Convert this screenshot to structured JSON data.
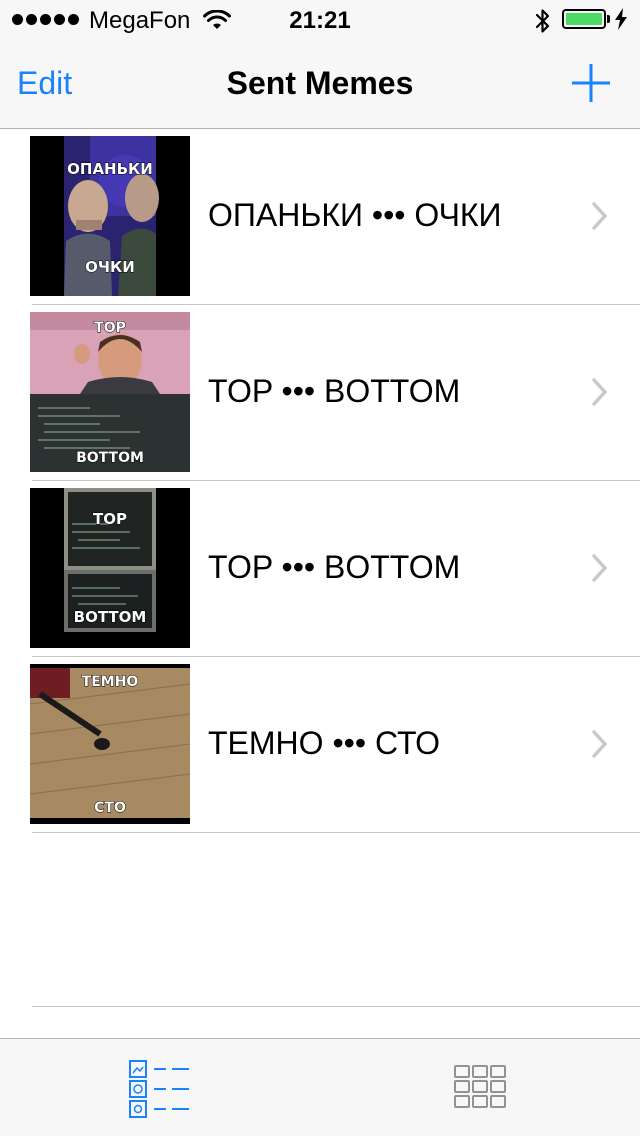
{
  "status_bar": {
    "carrier": "MegaFon",
    "time": "21:21",
    "battery_level": 1.0,
    "battery_color": "#4cd964"
  },
  "nav": {
    "edit_label": "Edit",
    "title": "Sent Memes",
    "add_icon": "plus-icon"
  },
  "memes": [
    {
      "label": "ОПАНЬКИ ••• ОЧКИ",
      "top_text": "ОПАНЬКИ",
      "bottom_text": "ОЧКИ"
    },
    {
      "label": "TOP ••• BOTTOM",
      "top_text": "TOP",
      "bottom_text": "BOTTOM"
    },
    {
      "label": "TOP ••• BOTTOM",
      "top_text": "TOP",
      "bottom_text": "BOTTOM"
    },
    {
      "label": "ТЕМНО ••• СТО",
      "top_text": "ТЕМНО",
      "bottom_text": "СТО"
    }
  ],
  "tab_bar": {
    "tabs": [
      {
        "icon": "table-list-icon",
        "selected": true
      },
      {
        "icon": "grid-collection-icon",
        "selected": false
      }
    ]
  },
  "colors": {
    "accent": "#1a82fb",
    "separator": "#c8c7cc",
    "chevron": "#c7c7cc",
    "inactive_tab": "#929292"
  }
}
